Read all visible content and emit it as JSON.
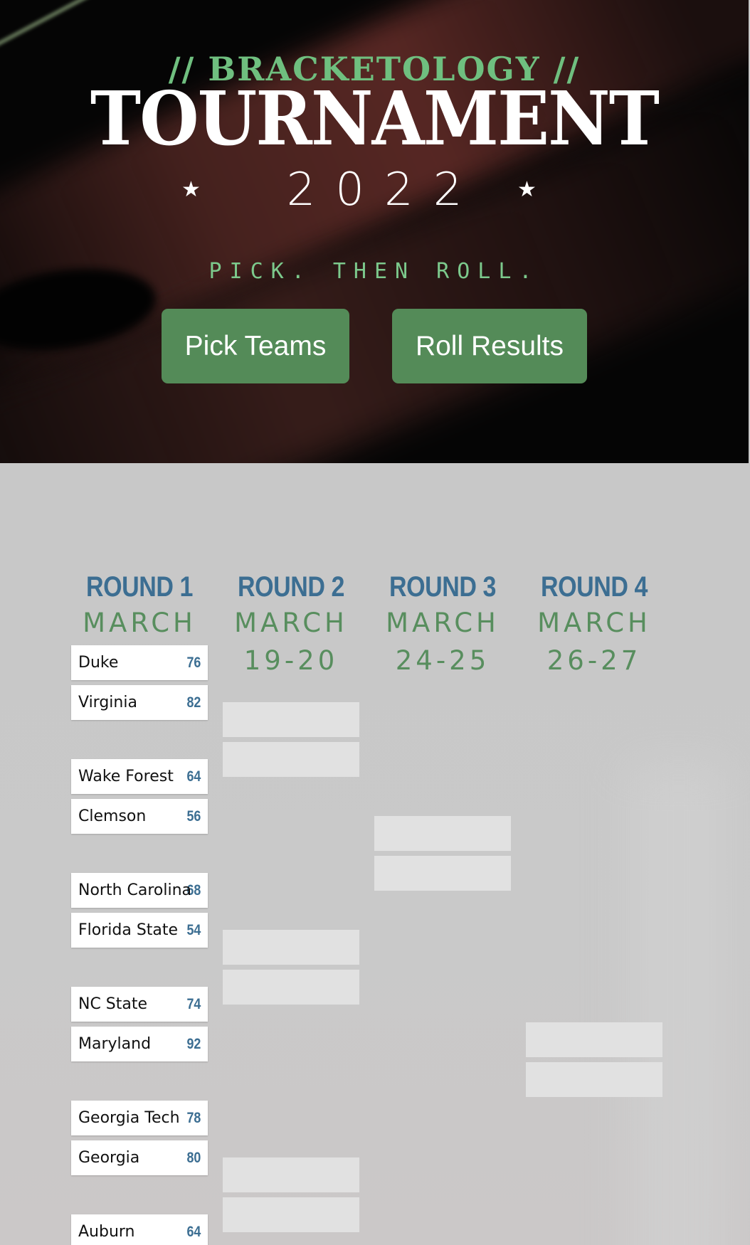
{
  "hero": {
    "eyebrow": "// BRACKETOLOGY //",
    "title": "TOURNAMENT",
    "year": "2022",
    "star_glyph": "★",
    "tagline": "PICK. THEN ROLL.",
    "buttons": {
      "pick": "Pick Teams",
      "roll": "Roll Results"
    }
  },
  "rounds": [
    {
      "title": "ROUND 1",
      "month": "MARCH",
      "days": ""
    },
    {
      "title": "ROUND 2",
      "month": "MARCH",
      "days": "19-20"
    },
    {
      "title": "ROUND 3",
      "month": "MARCH",
      "days": "24-25"
    },
    {
      "title": "ROUND 4",
      "month": "MARCH",
      "days": "26-27"
    }
  ],
  "round1_teams": [
    {
      "name": "Duke",
      "score": "76"
    },
    {
      "name": "Virginia",
      "score": "82"
    },
    {
      "name": "Wake Forest",
      "score": "64"
    },
    {
      "name": "Clemson",
      "score": "56"
    },
    {
      "name": "North Carolina",
      "score": "68"
    },
    {
      "name": "Florida State",
      "score": "54"
    },
    {
      "name": "NC State",
      "score": "74"
    },
    {
      "name": "Maryland",
      "score": "92"
    },
    {
      "name": "Georgia Tech",
      "score": "78"
    },
    {
      "name": "Georgia",
      "score": "80"
    },
    {
      "name": "Auburn",
      "score": "64"
    }
  ],
  "colors": {
    "accent_green": "#548b58",
    "eyebrow_green": "#6fbf7f",
    "round_blue": "#3c6e92",
    "date_green": "#588e5e"
  }
}
